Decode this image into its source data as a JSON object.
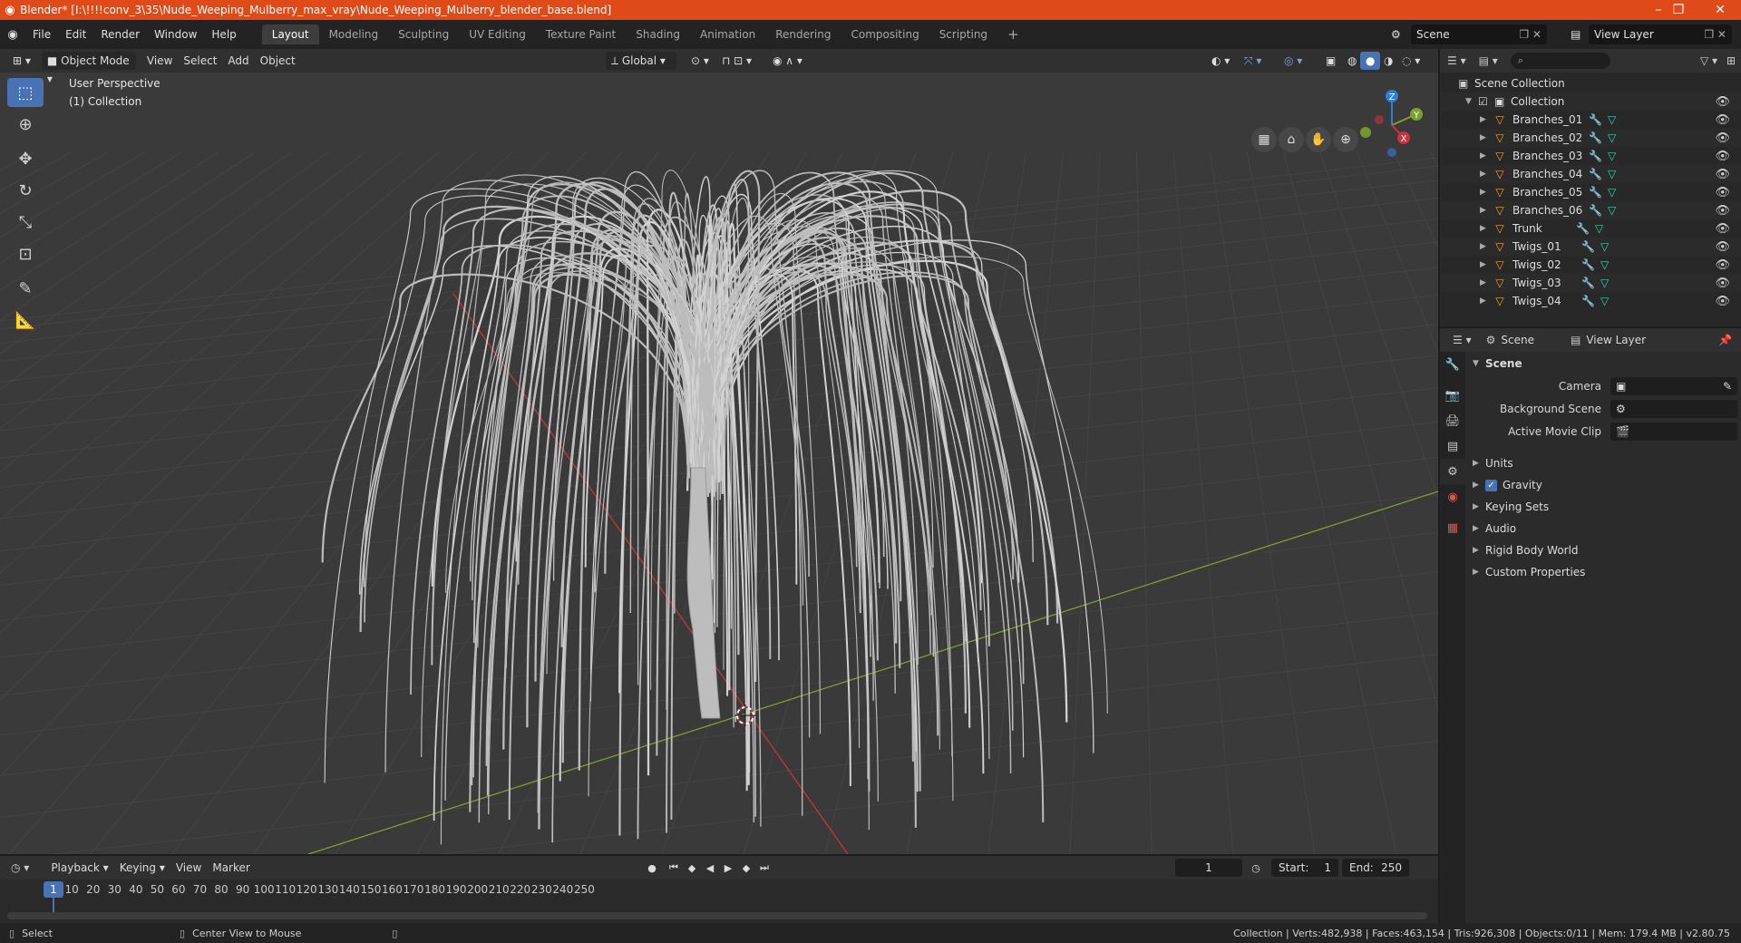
{
  "window": {
    "title": "Blender* [I:\\!!!!conv_3\\35\\Nude_Weeping_Mulberry_max_vray\\Nude_Weeping_Mulberry_blender_base.blend]",
    "controls": [
      "–",
      "❐",
      "✕"
    ]
  },
  "menu": [
    "File",
    "Edit",
    "Render",
    "Window",
    "Help"
  ],
  "workspaces": [
    "Layout",
    "Modeling",
    "Sculpting",
    "UV Editing",
    "Texture Paint",
    "Shading",
    "Animation",
    "Rendering",
    "Compositing",
    "Scripting"
  ],
  "active_workspace": "Layout",
  "add_workspace": "+",
  "scene_field": "Scene",
  "view_layer_field": "View Layer",
  "viewport": {
    "mode": "Object Mode",
    "menus": [
      "View",
      "Select",
      "Add",
      "Object"
    ],
    "transform_orientation": "Global",
    "perspective_label": "User Perspective",
    "collection_label": "(1) Collection",
    "gizmo_axes": [
      "Z",
      "Y",
      "X"
    ]
  },
  "outliner": {
    "root": "Scene Collection",
    "collection": "Collection",
    "objects": [
      "Branches_01",
      "Branches_02",
      "Branches_03",
      "Branches_04",
      "Branches_05",
      "Branches_06",
      "Trunk",
      "Twigs_01",
      "Twigs_02",
      "Twigs_03",
      "Twigs_04"
    ]
  },
  "properties": {
    "tabs": {
      "scene": "Scene",
      "view_layer": "View Layer"
    },
    "panel_title": "Scene",
    "fields": {
      "camera_label": "Camera",
      "background_scene_label": "Background Scene",
      "active_movie_clip_label": "Active Movie Clip"
    },
    "sections": [
      "Units",
      "Gravity",
      "Keying Sets",
      "Audio",
      "Rigid Body World",
      "Custom Properties"
    ],
    "gravity_checked": true
  },
  "timeline": {
    "menus": [
      "Playback",
      "Keying",
      "View",
      "Marker"
    ],
    "current_frame": "1",
    "start_label": "Start:",
    "start_value": "1",
    "end_label": "End:",
    "end_value": "250",
    "ticks": [
      "1",
      "10",
      "20",
      "30",
      "40",
      "50",
      "60",
      "70",
      "80",
      "90",
      "100",
      "110",
      "120",
      "130",
      "140",
      "150",
      "160",
      "170",
      "180",
      "190",
      "200",
      "210",
      "220",
      "230",
      "240",
      "250"
    ]
  },
  "statusbar": {
    "left_action": "Select",
    "middle_action": "Center View to Mouse",
    "stats": "Collection | Verts:482,938 | Faces:463,154 | Tris:926,308 | Objects:0/11 | Mem: 179.4 MB | v2.80.75"
  },
  "colors": {
    "titlebar": "#e04a18",
    "accent": "#4772b3",
    "x_axis": "#c8333c",
    "y_axis": "#7ca02c",
    "z_axis": "#2e7ed8"
  }
}
